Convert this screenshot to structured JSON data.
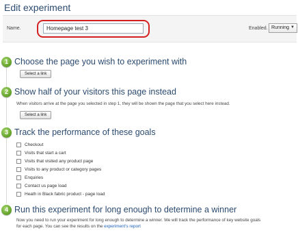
{
  "page": {
    "title": "Edit experiment"
  },
  "form": {
    "name_label": "Name.",
    "name_value": "Homepage test 3",
    "enabled_label": "Enabled.",
    "enabled_value": "Running",
    "highlight_color": "#d42020"
  },
  "steps": [
    {
      "number": "1",
      "title": "Choose the page you wish to experiment with",
      "button_label": "Select a link"
    },
    {
      "number": "2",
      "title": "Show half of your visitors this page instead",
      "description": "When visitors arrive at the page you selected in step 1, they will be shown the page that you select here instead.",
      "button_label": "Select a link"
    },
    {
      "number": "3",
      "title": "Track the performance of these goals",
      "goals": [
        "Checkout",
        "Visits that start a cart",
        "Visits that visited any product page",
        "Visits to any product or category pages",
        "Enquiries",
        "Contact us page load",
        "Heath in Black fabric product - page load"
      ]
    },
    {
      "number": "4",
      "title": "Run this experiment for long enough to determine a winner",
      "description_line1": "Now you need to run your experiment for long enough to determine a winner. We will track the performance of key website goals",
      "description_line2": "for each page. You can see the results on the",
      "report_link": "experiment's report"
    }
  ],
  "colors": {
    "title": "#2b4a6f",
    "step_badge": "#5e9e24",
    "link": "#1b5fb8"
  }
}
